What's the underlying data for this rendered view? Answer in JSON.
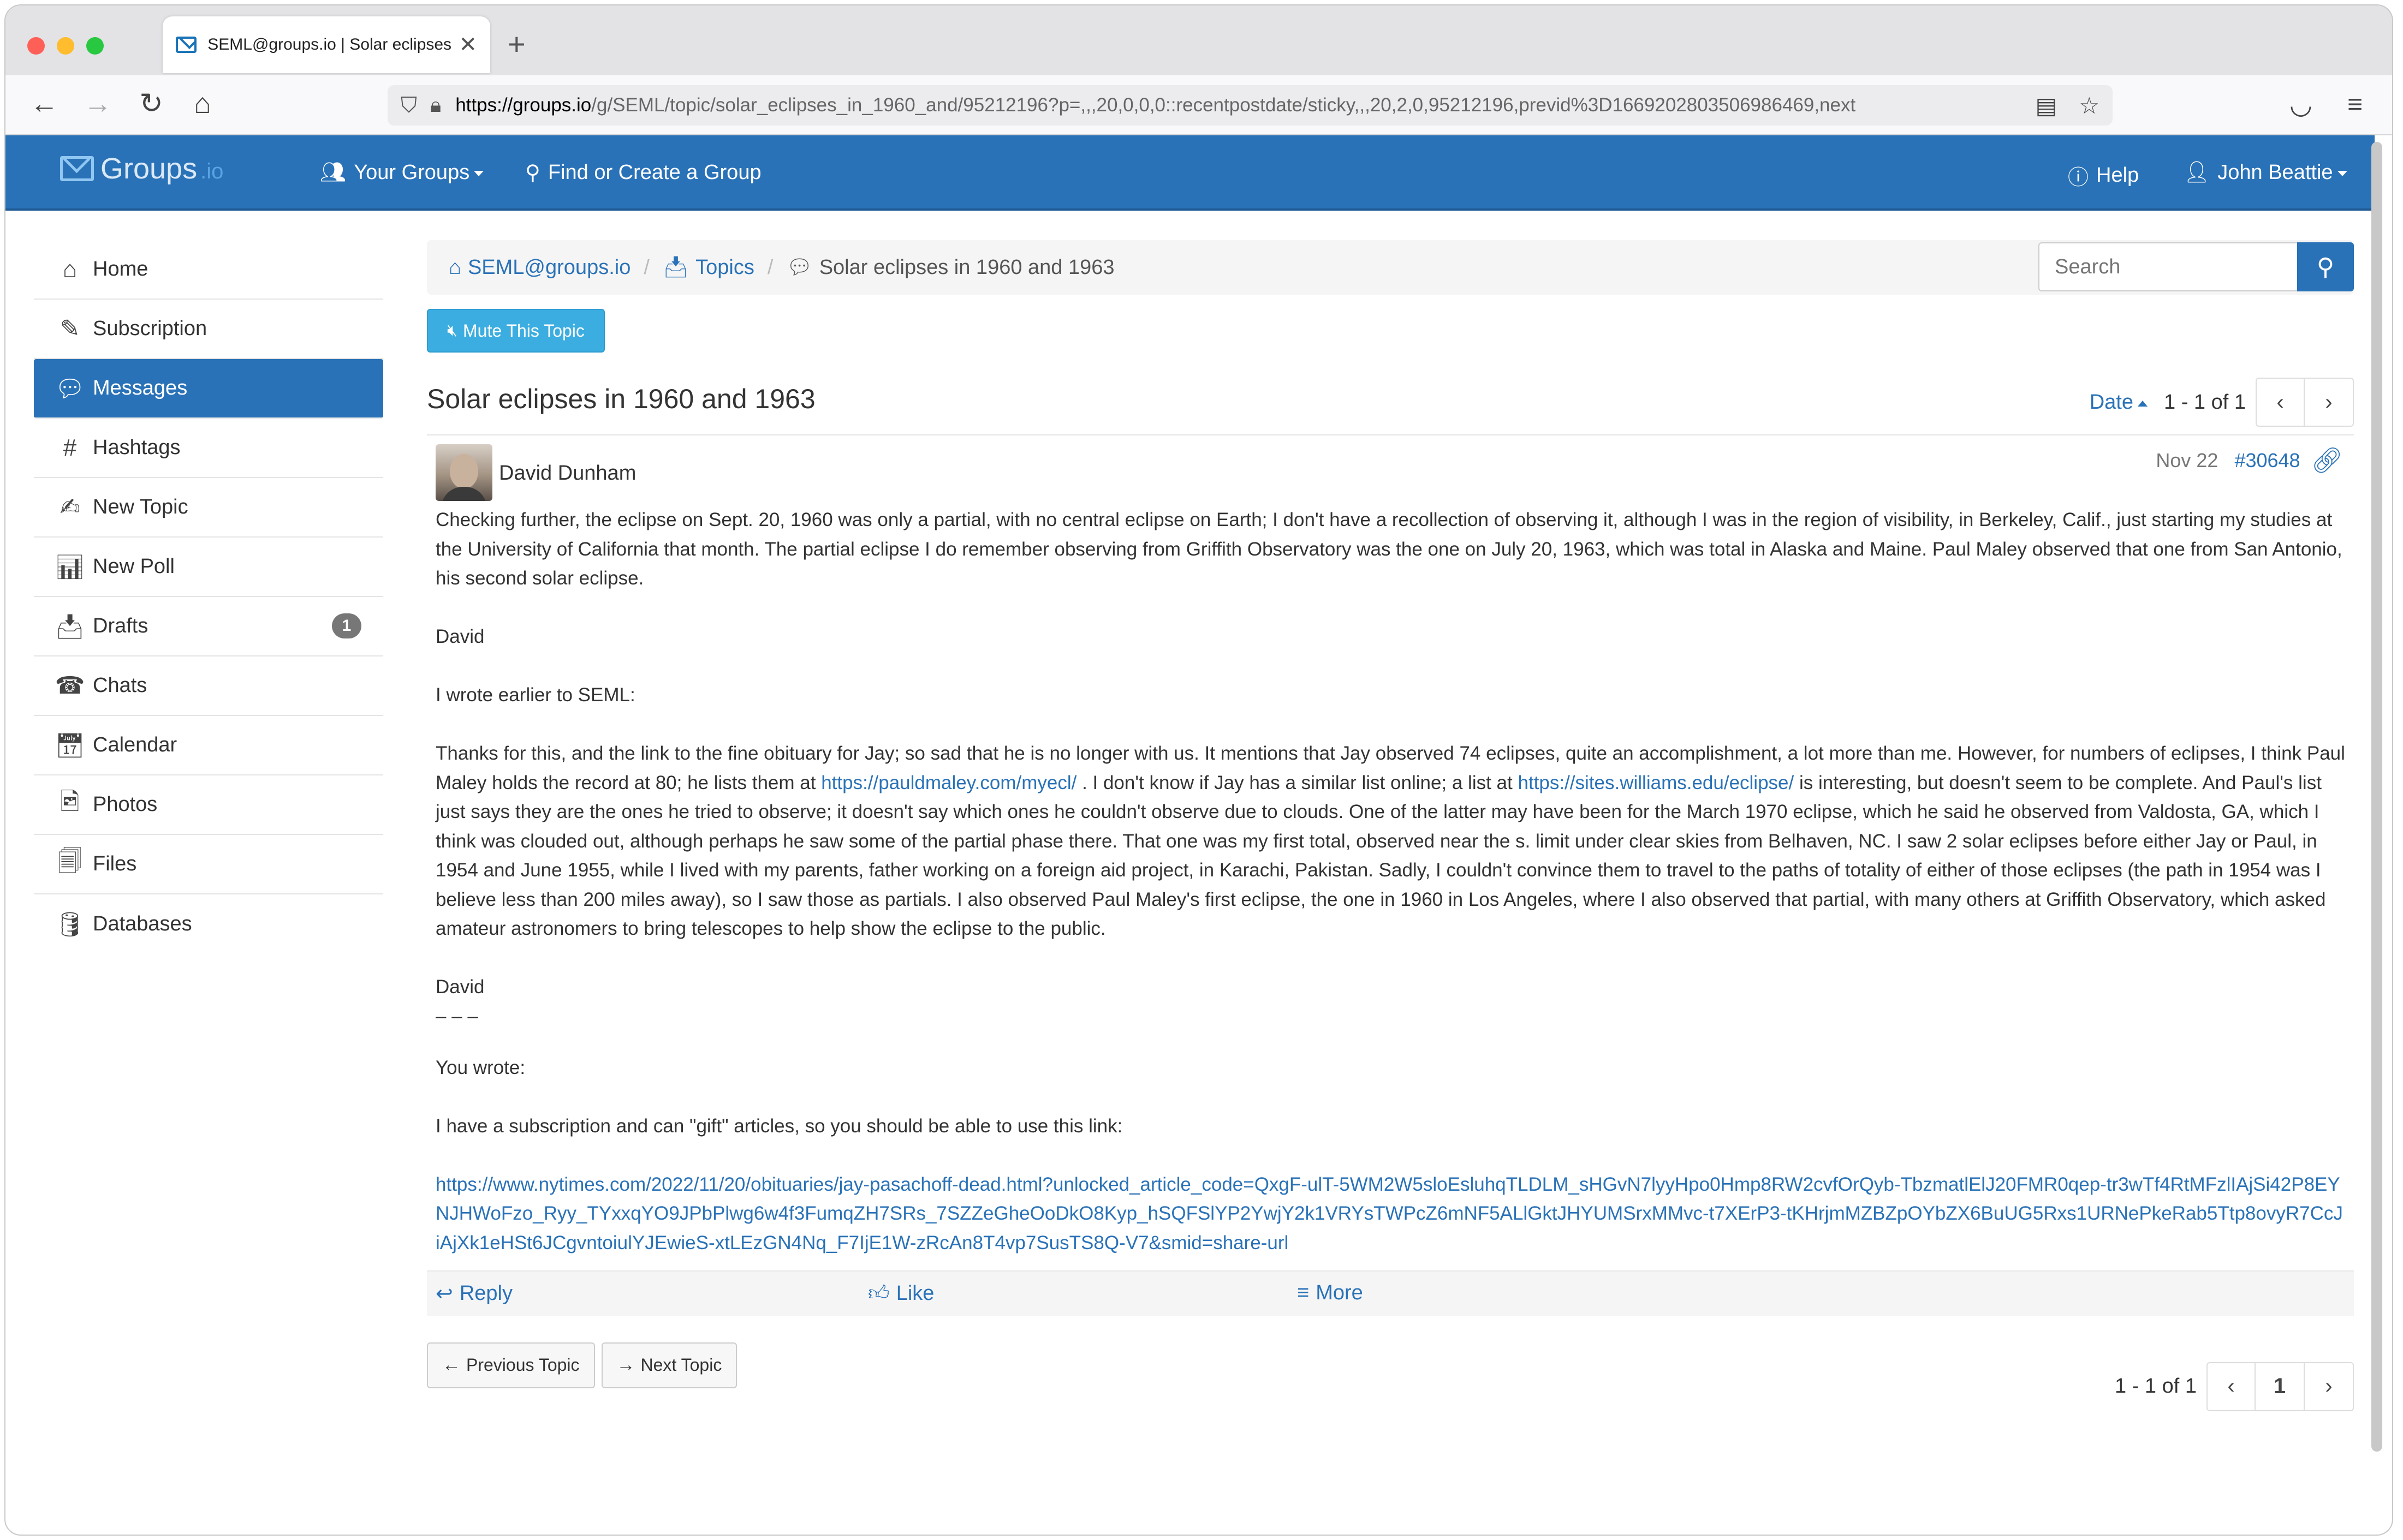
{
  "browser": {
    "tab_title": "SEML@groups.io | Solar eclipses",
    "tab_close": "✕",
    "new_tab": "+",
    "url_host": "https://groups.io",
    "url_path": "/g/SEML/topic/solar_eclipses_in_1960_and/95212196?p=,,,20,0,0,0::recentpostdate/sticky,,,20,2,0,95212196,previd%3D1669202803506986469,next"
  },
  "header": {
    "brand": "Groups",
    "brand_tld": ".io",
    "your_groups": "Your Groups",
    "find_group": "Find or Create a Group",
    "help": "Help",
    "user": "John Beattie"
  },
  "sidebar": {
    "items": [
      {
        "label": "Home",
        "icon": "home-icon"
      },
      {
        "label": "Subscription",
        "icon": "pencil-icon"
      },
      {
        "label": "Messages",
        "icon": "comments-icon"
      },
      {
        "label": "Hashtags",
        "icon": "hashtag-icon"
      },
      {
        "label": "New Topic",
        "icon": "edit-icon"
      },
      {
        "label": "New Poll",
        "icon": "bar-chart-icon"
      },
      {
        "label": "Drafts",
        "icon": "inbox-icon",
        "badge": "1"
      },
      {
        "label": "Chats",
        "icon": "phone-icon"
      },
      {
        "label": "Calendar",
        "icon": "calendar-icon"
      },
      {
        "label": "Photos",
        "icon": "photo-file-icon"
      },
      {
        "label": "Files",
        "icon": "files-icon"
      },
      {
        "label": "Databases",
        "icon": "database-icon"
      }
    ],
    "active_color": "#2a72b7"
  },
  "breadcrumb": {
    "group": "SEML@groups.io",
    "topics": "Topics",
    "current": "Solar eclipses in 1960 and 1963"
  },
  "search": {
    "placeholder": "Search"
  },
  "mute_label": "Mute This Topic",
  "topic": {
    "title": "Solar eclipses in 1960 and 1963",
    "sort_label": "Date",
    "pager": "1 - 1 of 1"
  },
  "message": {
    "author": "David Dunham",
    "date": "Nov 22",
    "number": "#30648",
    "p1": "Checking further, the eclipse on Sept. 20, 1960 was only a partial, with no central eclipse on Earth; I don't have a recollection of observing it, although I was in the region of visibility, in Berkeley, Calif., just starting my studies at the University of California that month. The partial eclipse I do remember observing from Griffith Observatory was the one on July 20, 1963, which was total in Alaska and Maine. Paul Maley observed that one from San Antonio, his second solar eclipse.",
    "sig1": "David",
    "p2": "I wrote earlier to SEML:",
    "p3a": "Thanks for this, and the link to the fine obituary for Jay; so sad that he is no longer with us. It mentions that Jay observed 74 eclipses, quite an accomplishment, a lot more than me. However, for numbers of eclipses, I think Paul Maley holds the record at 80; he lists them at ",
    "link1": "https://pauldmaley.com/myecl/",
    "p3b": " . I don't know if Jay has a similar list online; a list at ",
    "link2": "https://sites.williams.edu/eclipse/",
    "p3c": " is interesting, but doesn't seem to be complete. And Paul's list just says they are the ones he tried to observe; it doesn't say which ones he couldn't observe due to clouds. One of the latter may have been for the March 1970 eclipse, which he said he observed from Valdosta, GA, which I think was clouded out, although perhaps he saw some of the partial phase there.   That one was my first total, observed near the s. limit under clear skies from Belhaven, NC. I saw 2 solar eclipses before either Jay or Paul, in 1954 and June 1955, while I lived with my parents, father working on a foreign aid project, in Karachi, Pakistan. Sadly, I couldn't convince them to travel to the paths of totality of either of those eclipses (the path in 1954 was I believe less than 200 miles away), so I saw those as partials. I also observed Paul Maley's first eclipse, the one in 1960 in Los Angeles, where I also observed that partial, with many others at Griffith Observatory, which asked amateur astronomers to bring telescopes to help show the eclipse to the public.",
    "sig2": "David",
    "dashes": "– – –",
    "p4": "You wrote:",
    "p5": "I have a subscription and can \"gift\" articles, so you should be able to use this link:",
    "link3": " https://www.nytimes.com/2022/11/20/obituaries/jay-pasachoff-dead.html?unlocked_article_code=QxgF-ulT-5WM2W5sloEsluhqTLDLM_sHGvN7lyyHpo0Hmp8RW2cvfOrQyb-TbzmatlElJ20FMR0qep-tr3wTf4RtMFzlIAjSi42P8EYNJHWoFzo_Ryy_TYxxqYO9JPbPlwg6w4f3FumqZH7SRs_7SZZeGheOoDkO8Kyp_hSQFSlYP2YwjY2k1VRYsTWPcZ6mNF5ALlGktJHYUMSrxMMvc-t7XErP3-tKHrjmMZBZpOYbZX6BuUG5Rxs1URNePkeRab5Ttp8ovyR7CcJiAjXk1eHSt6JCgvntoiulYJEwieS-xtLEzGN4Nq_F7IjE1W-zRcAn8T4vp7SusTS8Q-V7&smid=share-url"
  },
  "actions": {
    "reply": "Reply",
    "like": "Like",
    "more": "More"
  },
  "nav": {
    "prev": "Previous Topic",
    "next": "Next Topic",
    "pager": "1 - 1 of 1",
    "page": "1"
  }
}
